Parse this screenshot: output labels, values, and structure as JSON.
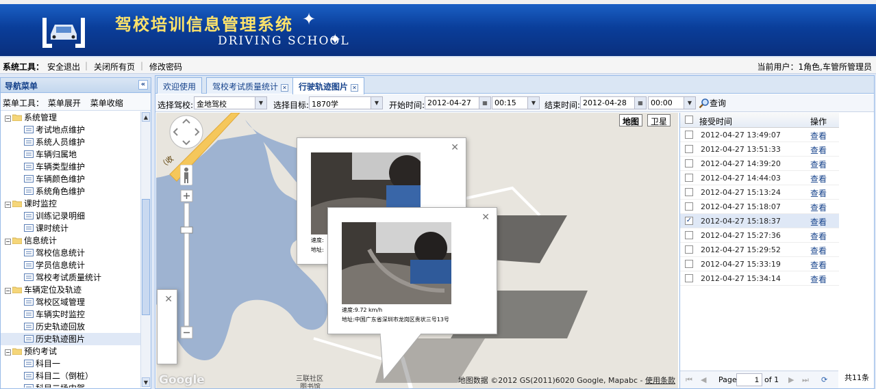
{
  "app": {
    "title": "驾校培训信息管理系统",
    "subtitle": "DRIVING SCHOOL"
  },
  "toolbar": {
    "label": "系统工具：",
    "logout": "安全退出",
    "close_all": "关闭所有页",
    "change_password": "修改密码",
    "current_user": "当前用户：1角色,车管所管理员"
  },
  "sidebar": {
    "title": "导航菜单",
    "tools_label": "菜单工具：",
    "expand": "菜单展开",
    "collapse": "菜单收缩",
    "nodes": [
      {
        "type": "folder",
        "label": "系统管理"
      },
      {
        "type": "leaf",
        "label": "考试地点维护"
      },
      {
        "type": "leaf",
        "label": "系统人员维护"
      },
      {
        "type": "leaf",
        "label": "车辆归属地"
      },
      {
        "type": "leaf",
        "label": "车辆类型维护"
      },
      {
        "type": "leaf",
        "label": "车辆颜色维护"
      },
      {
        "type": "leaf",
        "label": "系统角色维护"
      },
      {
        "type": "folder",
        "label": "课时监控"
      },
      {
        "type": "leaf",
        "label": "训练记录明细"
      },
      {
        "type": "leaf",
        "label": "课时统计"
      },
      {
        "type": "folder",
        "label": "信息统计"
      },
      {
        "type": "leaf",
        "label": "驾校信息统计"
      },
      {
        "type": "leaf",
        "label": "学员信息统计"
      },
      {
        "type": "leaf",
        "label": "驾校考试质量统计"
      },
      {
        "type": "folder",
        "label": "车辆定位及轨迹"
      },
      {
        "type": "leaf",
        "label": "驾校区域管理"
      },
      {
        "type": "leaf",
        "label": "车辆实时监控"
      },
      {
        "type": "leaf",
        "label": "历史轨迹回放"
      },
      {
        "type": "leaf",
        "label": "历史轨迹图片",
        "selected": true
      },
      {
        "type": "folder",
        "label": "预约考试"
      },
      {
        "type": "leaf",
        "label": "科目一"
      },
      {
        "type": "leaf",
        "label": "科目二（倒桩）"
      },
      {
        "type": "leaf",
        "label": "科目二场内驾"
      }
    ]
  },
  "tabs": [
    {
      "label": "欢迎使用",
      "closable": false,
      "active": false
    },
    {
      "label": "驾校考试质量统计",
      "closable": true,
      "active": false
    },
    {
      "label": "行驶轨迹图片",
      "closable": true,
      "active": true
    }
  ],
  "filters": {
    "school_label": "选择驾校:",
    "school_value": "金地驾校",
    "target_label": "选择目标:",
    "target_value": "1870学",
    "start_label": "开始时间:",
    "start_date": "2012-04-27",
    "start_time": "00:15",
    "end_label": "结束时间:",
    "end_date": "2012-04-28",
    "end_time": "00:00",
    "query": "查询"
  },
  "map": {
    "type_map": "地图",
    "type_satellite": "卫星",
    "road_label": "（收",
    "place_label_1": "三联社区",
    "place_label_2": "图书馆",
    "logo": "Google",
    "copyright": "地图数据 ©2012 GS(2011)6020 Google, Mapabc - ",
    "terms": "使用条款",
    "popup_back": {
      "speed": "速度:",
      "addr": "地址:"
    },
    "popup_front": {
      "speed": "速度:9.72 km/h",
      "addr": "地址:中国广东省深圳市龙岗区贵状三号13号"
    }
  },
  "grid": {
    "col_time": "接受时间",
    "col_action": "操作",
    "action_label": "查看",
    "rows": [
      {
        "time": "2012-04-27 13:49:07",
        "checked": false
      },
      {
        "time": "2012-04-27 13:51:33",
        "checked": false
      },
      {
        "time": "2012-04-27 14:39:20",
        "checked": false
      },
      {
        "time": "2012-04-27 14:44:03",
        "checked": false
      },
      {
        "time": "2012-04-27 15:13:24",
        "checked": false
      },
      {
        "time": "2012-04-27 15:18:07",
        "checked": false
      },
      {
        "time": "2012-04-27 15:18:37",
        "checked": true
      },
      {
        "time": "2012-04-27 15:27:36",
        "checked": false
      },
      {
        "time": "2012-04-27 15:29:52",
        "checked": false
      },
      {
        "time": "2012-04-27 15:33:19",
        "checked": false
      },
      {
        "time": "2012-04-27 15:34:14",
        "checked": false
      }
    ]
  },
  "pager": {
    "page_label": "Page",
    "page_value": "1",
    "of_label": "of 1",
    "total": "共11条"
  },
  "colors": {
    "banner": "#0a3e9a",
    "title_yellow": "#ffe36a",
    "panel_border": "#99bbe8",
    "water": "#9eb3d1",
    "road_yellow": "#f5c75b"
  }
}
